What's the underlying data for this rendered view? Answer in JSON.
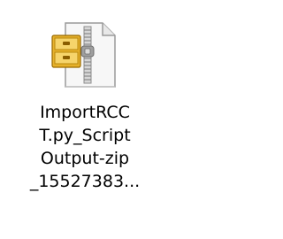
{
  "desktop_item": {
    "icon": "zip-archive-icon",
    "name_lines": [
      "ImportRCC",
      "T.py_Script",
      "Output-zip",
      "_15527383..."
    ]
  },
  "colors": {
    "background": "#ffffff",
    "label_text": "#000000",
    "folder_yellow": "#f1c232",
    "zipper_gray": "#8c8c8c"
  }
}
